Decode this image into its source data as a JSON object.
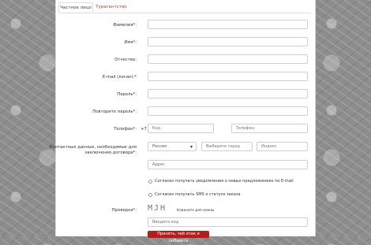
{
  "tabs": {
    "individual": "Частное лицо",
    "agency": "Турагентство"
  },
  "fields": {
    "lastname": "Фамилия*:",
    "firstname": "Имя*:",
    "patronymic": "Отчество:",
    "email": "E-mail (логин):*",
    "password": "Пароль*:",
    "password_repeat": "Повторите пароль*:",
    "phone": "Телефон*:",
    "phone_prefix": "+7",
    "phone_code_placeholder": "Код",
    "phone_number_placeholder": "Телефон",
    "contact_line1": "Контактные данные, необходимые для",
    "contact_line2": "заключения договора*:",
    "country_value": "Россия",
    "city_placeholder": "Выберите город",
    "zip_placeholder": "Индекс",
    "address_placeholder": "Адрес",
    "captcha_label": "Проверка*:",
    "captcha_text": "MJH",
    "captcha_hint": "Кликните для смены",
    "captcha_placeholder": "Введите код"
  },
  "checkboxes": {
    "email_notify": "Согласен получать уведомления о новых предложениях по E-mail",
    "sms_notify": "Согласен получать SMS о статусе заказа"
  },
  "submit_label": "Принять, чей итак и побавить"
}
